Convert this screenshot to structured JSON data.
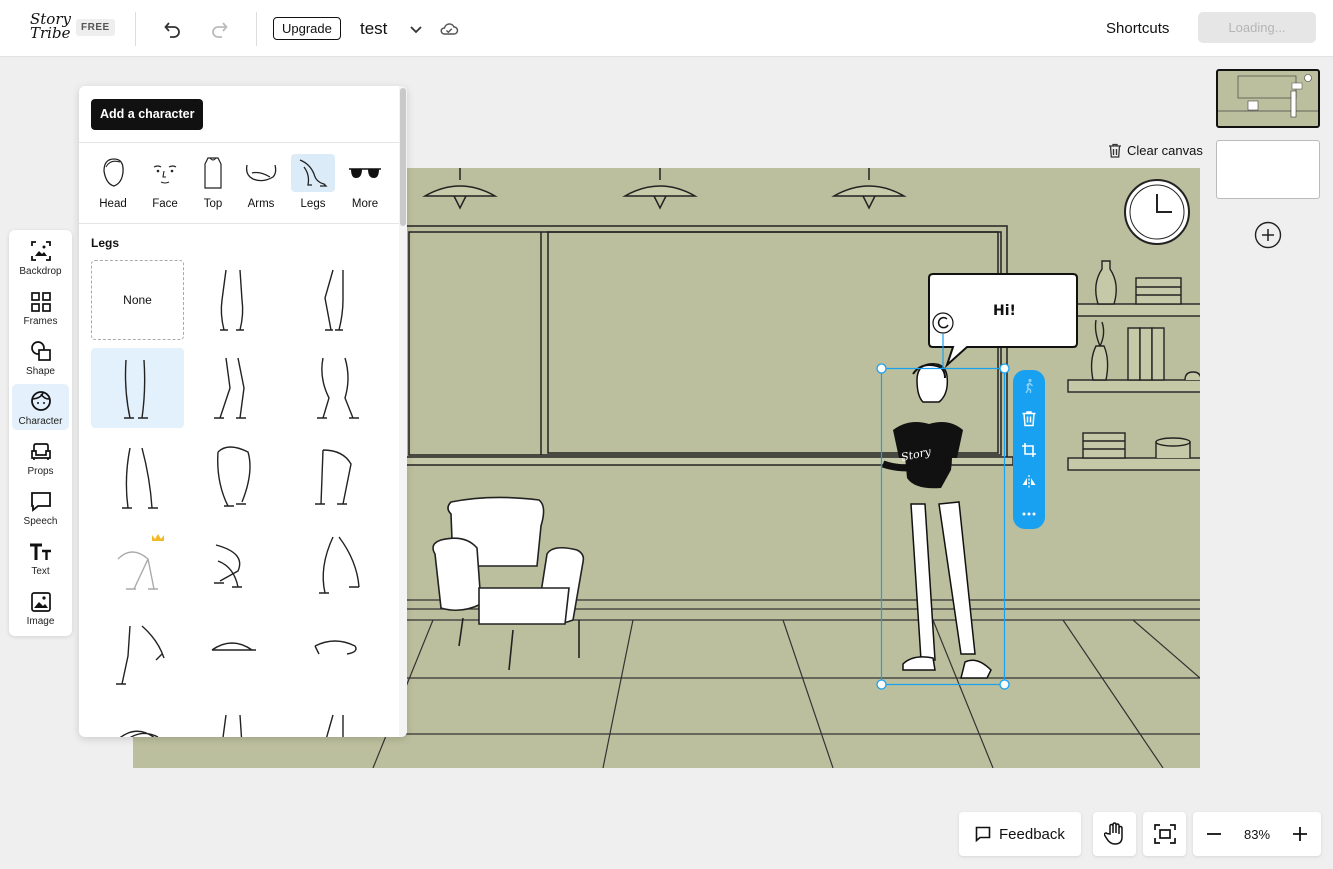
{
  "app": {
    "logo_text": "Story Tribe",
    "plan_badge": "FREE",
    "upgrade_label": "Upgrade",
    "project_name": "test",
    "shortcuts_label": "Shortcuts",
    "loading_label": "Loading..."
  },
  "toolbar": {
    "items": [
      {
        "label": "Backdrop",
        "icon": "backdrop-icon"
      },
      {
        "label": "Frames",
        "icon": "frames-icon"
      },
      {
        "label": "Shape",
        "icon": "shape-icon"
      },
      {
        "label": "Character",
        "icon": "character-icon",
        "active": true
      },
      {
        "label": "Props",
        "icon": "props-icon"
      },
      {
        "label": "Speech",
        "icon": "speech-icon"
      },
      {
        "label": "Text",
        "icon": "text-icon"
      },
      {
        "label": "Image",
        "icon": "image-icon"
      }
    ]
  },
  "panel": {
    "add_character_label": "Add a character",
    "categories": [
      {
        "label": "Head"
      },
      {
        "label": "Face"
      },
      {
        "label": "Top"
      },
      {
        "label": "Arms"
      },
      {
        "label": "Legs",
        "active": true
      },
      {
        "label": "More"
      }
    ],
    "section_title": "Legs",
    "none_label": "None"
  },
  "canvas": {
    "clear_label": "Clear canvas",
    "speech_text": "Hi!",
    "tee_print": "Story"
  },
  "bottom": {
    "feedback_label": "Feedback",
    "zoom_value": "83%"
  },
  "colors": {
    "canvas_bg": "#bcbf9d",
    "selection": "#18a1f0",
    "primary_dark": "#111111"
  }
}
